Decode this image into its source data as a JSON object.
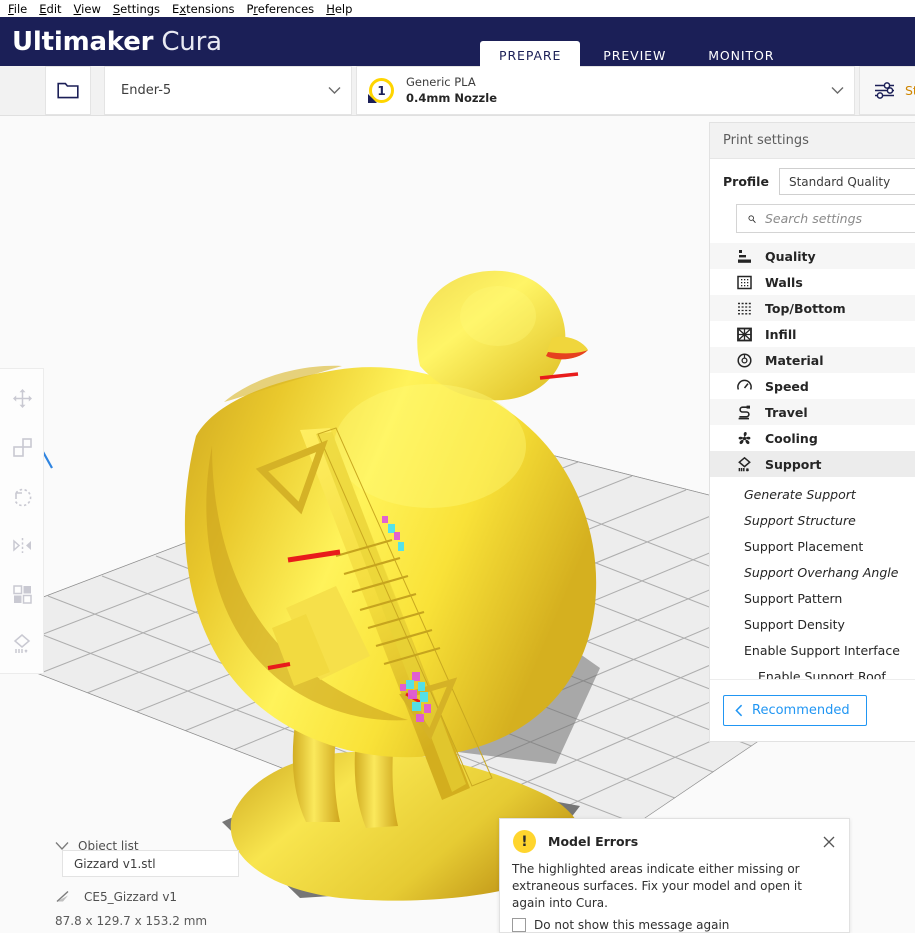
{
  "menubar": {
    "items": [
      {
        "label": "File",
        "accel": "F"
      },
      {
        "label": "Edit",
        "accel": "E"
      },
      {
        "label": "View",
        "accel": "V"
      },
      {
        "label": "Settings",
        "accel": "S"
      },
      {
        "label": "Extensions",
        "accel": "x"
      },
      {
        "label": "Preferences",
        "accel": "r"
      },
      {
        "label": "Help",
        "accel": "H"
      }
    ]
  },
  "titlebar": {
    "brand_bold": "Ultimaker",
    "brand_light": "Cura",
    "background": "#1b1f57"
  },
  "stages": [
    {
      "label": "PREPARE",
      "active": true
    },
    {
      "label": "PREVIEW",
      "active": false
    },
    {
      "label": "MONITOR",
      "active": false
    }
  ],
  "actionbar": {
    "open_file_icon": "folder-icon",
    "machine": {
      "name": "Ender-5",
      "chevron": "chevron-down-icon"
    },
    "material": {
      "extruder_number": "1",
      "line1": "Generic PLA",
      "line2": "0.4mm Nozzle",
      "chevron": "chevron-down-icon"
    },
    "profile_button": {
      "icon": "sliders-icon",
      "label": "Sta"
    }
  },
  "toolbar": {
    "tools": [
      {
        "name": "move-tool",
        "icon": "move-icon"
      },
      {
        "name": "scale-tool",
        "icon": "scale-icon"
      },
      {
        "name": "rotate-tool",
        "icon": "rotate-icon"
      },
      {
        "name": "mirror-tool",
        "icon": "mirror-icon"
      },
      {
        "name": "per-model-settings-tool",
        "icon": "per-model-settings-icon"
      },
      {
        "name": "support-blocker-tool",
        "icon": "support-blocker-icon"
      }
    ]
  },
  "print_settings": {
    "header": "Print settings",
    "profile_label": "Profile",
    "profile_value": "Standard Quality",
    "search_placeholder": "Search settings",
    "search_value": "",
    "search_icon": "search-icon",
    "categories": [
      {
        "label": "Quality",
        "icon": "quality-icon",
        "highlighted": false
      },
      {
        "label": "Walls",
        "icon": "walls-icon",
        "highlighted": false
      },
      {
        "label": "Top/Bottom",
        "icon": "topbottom-icon",
        "highlighted": false
      },
      {
        "label": "Infill",
        "icon": "infill-icon",
        "highlighted": false
      },
      {
        "label": "Material",
        "icon": "material-icon",
        "highlighted": false
      },
      {
        "label": "Speed",
        "icon": "speed-icon",
        "highlighted": false
      },
      {
        "label": "Travel",
        "icon": "travel-icon",
        "highlighted": false
      },
      {
        "label": "Cooling",
        "icon": "cooling-icon",
        "highlighted": false
      },
      {
        "label": "Support",
        "icon": "support-icon",
        "highlighted": true
      }
    ],
    "support_settings": [
      {
        "label": "Generate Support",
        "italic": true,
        "indent": false
      },
      {
        "label": "Support Structure",
        "italic": true,
        "indent": false
      },
      {
        "label": "Support Placement",
        "italic": false,
        "indent": false
      },
      {
        "label": "Support Overhang Angle",
        "italic": true,
        "indent": false
      },
      {
        "label": "Support Pattern",
        "italic": false,
        "indent": false
      },
      {
        "label": "Support Density",
        "italic": false,
        "indent": false
      },
      {
        "label": "Enable Support Interface",
        "italic": false,
        "indent": false
      },
      {
        "label": "Enable Support Roof",
        "italic": false,
        "indent": true
      }
    ],
    "recommended_button": {
      "label": "Recommended",
      "chevron": "chevron-left-icon",
      "color": "#2196f3"
    }
  },
  "object_list": {
    "toggle_label": "Object list",
    "toggle_icon": "chevron-down-icon",
    "popup_item": "Gizzard v1.stl",
    "model_icon": "model-icon",
    "model_name": "CE5_Gizzard v1",
    "dimensions": "87.8 x 129.7 x 153.2 mm"
  },
  "model_errors_dialog": {
    "warning_icon": "warning-icon",
    "title": "Model Errors",
    "close_icon": "close-icon",
    "body": "The highlighted areas indicate either missing or extraneous surfaces. Fix your model and open it again into Cura.",
    "checkbox_label": "Do not show this message again",
    "checkbox_checked": false,
    "accent": "#ffd52e"
  },
  "viewport": {
    "background": "#fafafa",
    "buildplate_color": "#ececec",
    "grid_line_color": "#a9a9a9",
    "volume_edge_color": "#2f84e0",
    "model_color": "#f7d900",
    "model_shadow": "#6f6f6f",
    "error_color_a": "#e81b1b",
    "error_color_b": "#4de2f0",
    "error_color_c": "#e05ad8"
  }
}
